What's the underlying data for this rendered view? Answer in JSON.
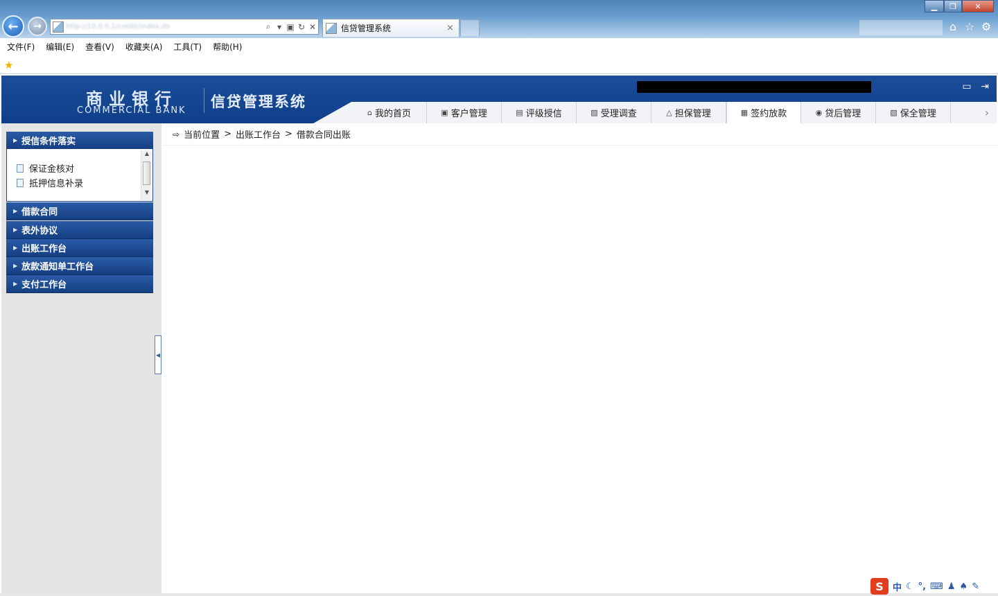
{
  "browser": {
    "address": "http://10.0.0.1/credit/index.do",
    "tab_title": "信贷管理系统",
    "tab_close": "×",
    "menu": [
      "文件(F)",
      "编辑(E)",
      "查看(V)",
      "收藏夹(A)",
      "工具(T)",
      "帮助(H)"
    ]
  },
  "header": {
    "bank_name_cn": "商业银行",
    "bank_name_en": "COMMERCIAL BANK",
    "system_title": "信贷管理系统"
  },
  "nav": {
    "tabs": [
      {
        "label": "我的首页",
        "icon": "home-icon"
      },
      {
        "label": "客户管理",
        "icon": "customer-icon"
      },
      {
        "label": "评级授信",
        "icon": "rating-icon"
      },
      {
        "label": "受理调查",
        "icon": "survey-icon"
      },
      {
        "label": "担保管理",
        "icon": "guarantee-icon"
      },
      {
        "label": "签约放款",
        "icon": "contract-icon"
      },
      {
        "label": "贷后管理",
        "icon": "postloan-icon"
      },
      {
        "label": "保全管理",
        "icon": "preservation-icon"
      }
    ],
    "active": "签约放款"
  },
  "sidebar": {
    "groups": [
      {
        "label": "授信条件落实",
        "expanded": true,
        "items": [
          "保证金核对",
          "抵押信息补录"
        ]
      },
      {
        "label": "借款合同"
      },
      {
        "label": "表外协议"
      },
      {
        "label": "出账工作台"
      },
      {
        "label": "放款通知单工作台"
      },
      {
        "label": "支付工作台"
      }
    ]
  },
  "breadcrumb": {
    "prefix": "当前位置",
    "sep1": ">",
    "level1": "出账工作台",
    "sep2": ">",
    "level2": "借款合同出账"
  },
  "ime": {
    "logo": "S",
    "mode": "中"
  },
  "colors": {
    "header_blue": "#1c4d98",
    "sidebar_bg": "#e4e4e4",
    "accordion_blue": "#2a5ba6"
  }
}
